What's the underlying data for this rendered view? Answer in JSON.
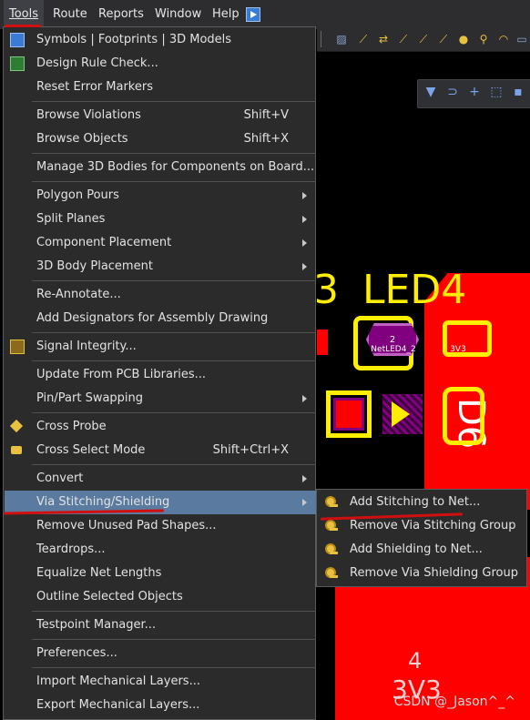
{
  "menubar": {
    "items": [
      "Tools",
      "Route",
      "Reports",
      "Window",
      "Help"
    ]
  },
  "tools_menu": {
    "items": [
      {
        "label": "Symbols | Footprints | 3D Models",
        "shortcut": "",
        "submenu": false
      },
      {
        "label": "Design Rule Check...",
        "shortcut": "",
        "submenu": false
      },
      {
        "label": "Reset Error Markers",
        "shortcut": "",
        "submenu": false
      },
      {
        "label": "Browse Violations",
        "shortcut": "Shift+V",
        "submenu": false
      },
      {
        "label": "Browse Objects",
        "shortcut": "Shift+X",
        "submenu": false
      },
      {
        "label": "Manage 3D Bodies for Components on Board...",
        "shortcut": "",
        "submenu": false
      },
      {
        "label": "Polygon Pours",
        "shortcut": "",
        "submenu": true
      },
      {
        "label": "Split Planes",
        "shortcut": "",
        "submenu": true
      },
      {
        "label": "Component Placement",
        "shortcut": "",
        "submenu": true
      },
      {
        "label": "3D Body Placement",
        "shortcut": "",
        "submenu": true
      },
      {
        "label": "Re-Annotate...",
        "shortcut": "",
        "submenu": false
      },
      {
        "label": "Add Designators for Assembly Drawing",
        "shortcut": "",
        "submenu": false
      },
      {
        "label": "Signal Integrity...",
        "shortcut": "",
        "submenu": false
      },
      {
        "label": "Update From PCB Libraries...",
        "shortcut": "",
        "submenu": false
      },
      {
        "label": "Pin/Part Swapping",
        "shortcut": "",
        "submenu": true
      },
      {
        "label": "Cross Probe",
        "shortcut": "",
        "submenu": false
      },
      {
        "label": "Cross Select Mode",
        "shortcut": "Shift+Ctrl+X",
        "submenu": false
      },
      {
        "label": "Convert",
        "shortcut": "",
        "submenu": true
      },
      {
        "label": "Via Stitching/Shielding",
        "shortcut": "",
        "submenu": true
      },
      {
        "label": "Remove Unused Pad Shapes...",
        "shortcut": "",
        "submenu": false
      },
      {
        "label": "Teardrops...",
        "shortcut": "",
        "submenu": false
      },
      {
        "label": "Equalize Net Lengths",
        "shortcut": "",
        "submenu": false
      },
      {
        "label": "Outline Selected Objects",
        "shortcut": "",
        "submenu": false
      },
      {
        "label": "Testpoint Manager...",
        "shortcut": "",
        "submenu": false
      },
      {
        "label": "Preferences...",
        "shortcut": "",
        "submenu": false
      },
      {
        "label": "Import Mechanical Layers...",
        "shortcut": "",
        "submenu": false
      },
      {
        "label": "Export Mechanical Layers...",
        "shortcut": "",
        "submenu": false
      }
    ],
    "highlighted": "Via Stitching/Shielding"
  },
  "submenu": {
    "items": [
      {
        "label": "Add Stitching to Net..."
      },
      {
        "label": "Remove Via Stitching Group"
      },
      {
        "label": "Add Shielding to Net..."
      },
      {
        "label": "Remove Via Shielding Group"
      }
    ]
  },
  "pcb": {
    "designator_led": "LED4",
    "designator_prefix": "3",
    "designator_d": "D6",
    "pad_num": "2",
    "pad_net": "NetLED4_2",
    "pad_3v3": "3V3",
    "big_pad_num": "4",
    "big_pad_net": "3V3"
  },
  "watermark": "CSDN @_Jason^_^",
  "colors": {
    "highlight": "#5a7aa0",
    "menu_bg": "#2b2b2b",
    "copper_red": "#ff0000",
    "silk_yellow": "#ffee00"
  }
}
